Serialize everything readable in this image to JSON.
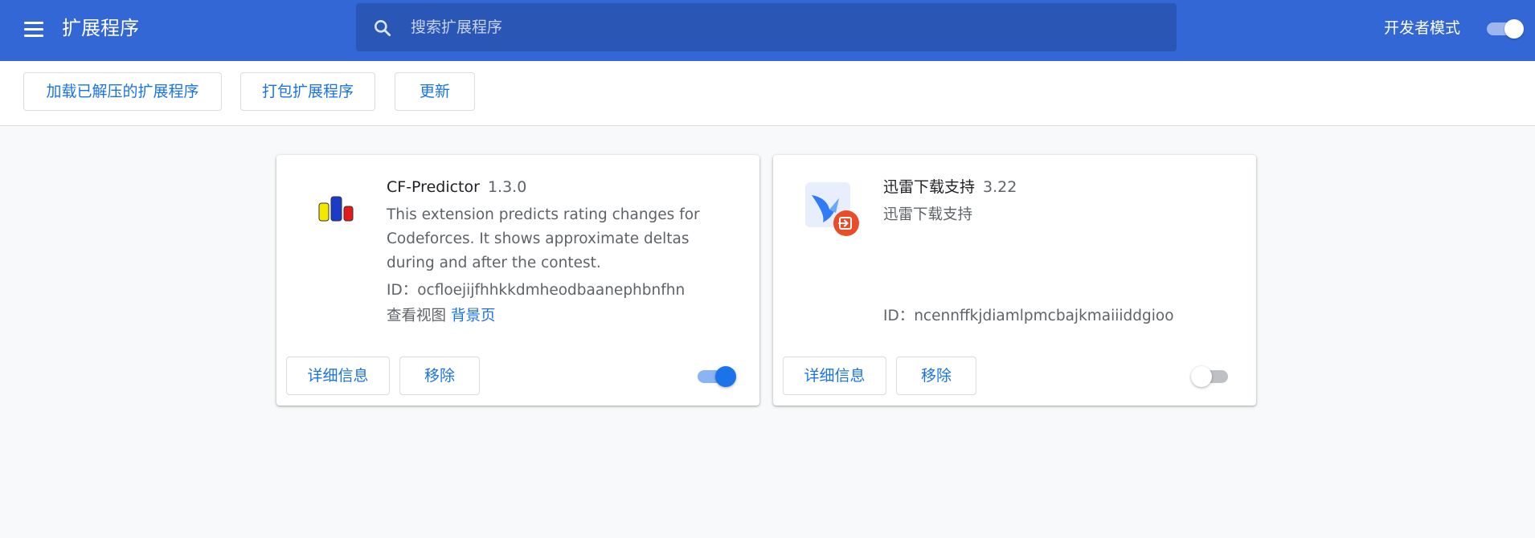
{
  "header": {
    "title": "扩展程序",
    "search_placeholder": "搜索扩展程序",
    "dev_mode_label": "开发者模式",
    "dev_mode_on": true
  },
  "toolbar": {
    "load_unpacked": "加载已解压的扩展程序",
    "pack_extension": "打包扩展程序",
    "update": "更新"
  },
  "extensions": [
    {
      "name": "CF-Predictor",
      "version": "1.3.0",
      "description": "This extension predicts rating changes for Codeforces. It shows approximate deltas during and after the contest.",
      "id_label": "ID：",
      "id": "ocfloejijfhhkkdmheodbaanephbnfhn",
      "views_label": "查看视图",
      "views_link": "背景页",
      "details_label": "详细信息",
      "remove_label": "移除",
      "enabled": true,
      "icon": "cf-predictor-bars-icon"
    },
    {
      "name": "迅雷下载支持",
      "version": "3.22",
      "description": "迅雷下载支持",
      "id_label": "ID：",
      "id": "ncennffkjdiamlpmcbajkmaiiiddgioo",
      "details_label": "详细信息",
      "remove_label": "移除",
      "enabled": false,
      "icon": "thunder-bird-icon"
    }
  ],
  "colors": {
    "header_bg": "#3367d6",
    "search_bg": "#2a56b6",
    "accent": "#1a73e8"
  }
}
